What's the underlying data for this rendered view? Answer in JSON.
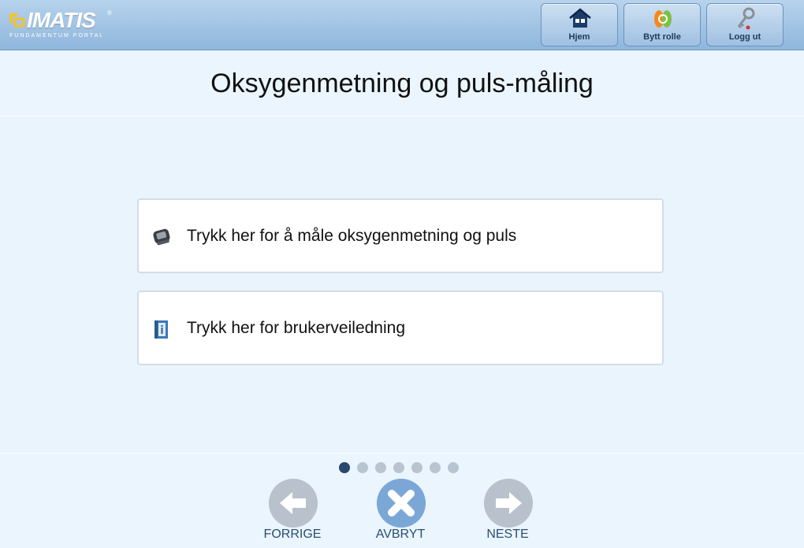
{
  "brand": {
    "name": "IMATIS",
    "registered": "®",
    "subtitle": "FUNDAMENTUM PORTAL"
  },
  "header": {
    "buttons": [
      {
        "label": "Hjem",
        "icon": "home-icon"
      },
      {
        "label": "Bytt rolle",
        "icon": "switch-role-icon"
      },
      {
        "label": "Logg ut",
        "icon": "key-icon"
      }
    ]
  },
  "page": {
    "title": "Oksygenmetning og puls-måling"
  },
  "options": [
    {
      "label": "Trykk her for å måle oksygenmetning og puls",
      "icon": "pulse-oximeter-icon"
    },
    {
      "label": "Trykk her for brukerveiledning",
      "icon": "user-guide-icon"
    }
  ],
  "pagination": {
    "total": 7,
    "current": 1
  },
  "nav": {
    "prev_label": "FORRIGE",
    "cancel_label": "AVBRYT",
    "next_label": "NESTE"
  },
  "colors": {
    "header": "#9fc0e2",
    "background": "#e9f4fd",
    "active_dot": "#27486b",
    "cancel": "#7ba7d6",
    "disabled_nav": "#b9c2cc"
  }
}
